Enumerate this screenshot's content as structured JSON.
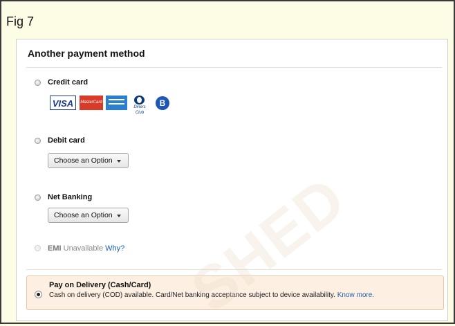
{
  "figure_label": "Fig 7",
  "panel": {
    "title": "Another payment method",
    "options": {
      "credit_card": {
        "label": "Credit card",
        "selected": false
      },
      "debit_card": {
        "label": "Debit card",
        "dropdown": "Choose an Option",
        "selected": false
      },
      "net_banking": {
        "label": "Net Banking",
        "dropdown": "Choose an Option",
        "selected": false
      },
      "emi": {
        "label": "EMI",
        "status": "Unavailable",
        "link": "Why?",
        "disabled": true
      },
      "pay_on_delivery": {
        "label": "Pay on Delivery (Cash/Card)",
        "description": "Cash on delivery (COD) available. Card/Net banking acceptance subject to device availability.",
        "link": "Know more.",
        "selected": true
      }
    },
    "card_logos": {
      "visa": "VISA",
      "mastercard": "MasterCard",
      "diners": "Diners Club",
      "b_card": "B"
    }
  },
  "watermark": "SHED",
  "colors": {
    "figure_background": "#fdfde6",
    "link": "#1a5fb4",
    "pod_highlight": "#fdf0e3"
  }
}
